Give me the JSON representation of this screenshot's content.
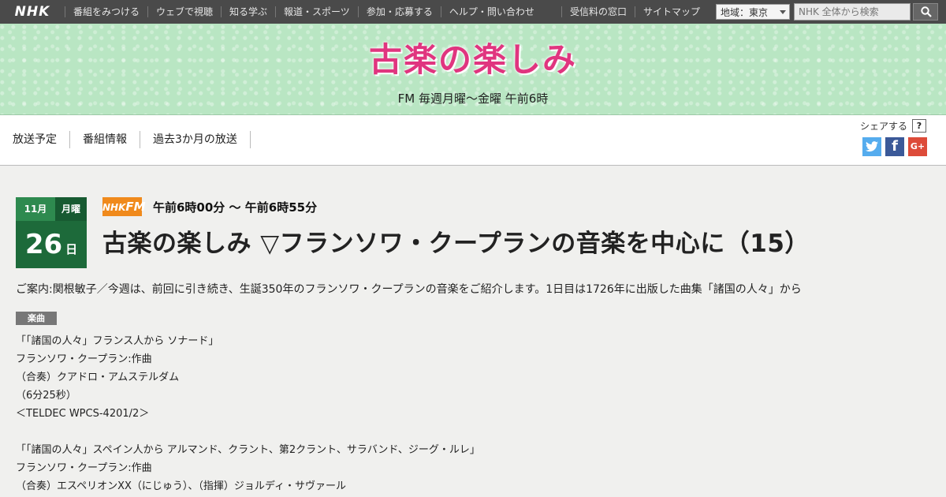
{
  "global_nav": {
    "logo": "NHK",
    "left_items": [
      "番組をみつける",
      "ウェブで視聴",
      "知る学ぶ",
      "報道・スポーツ",
      "参加・応募する",
      "ヘルプ・問い合わせ"
    ],
    "right_items": [
      "受信料の窓口",
      "サイトマップ"
    ],
    "region_label": "地域：東京",
    "search_placeholder": "NHK 全体から検索"
  },
  "banner": {
    "title": "古楽の楽しみ",
    "schedule": "FM 毎週月曜～金曜 午前6時"
  },
  "subnav": {
    "tabs": [
      "放送予定",
      "番組情報",
      "過去3か月の放送"
    ],
    "share_label": "シェアする",
    "help_label": "?",
    "sns": {
      "twitter": "t",
      "facebook": "f",
      "googleplus": "G+"
    }
  },
  "episode": {
    "month": "11月",
    "weekday": "月曜",
    "day": "26",
    "day_unit": "日",
    "channel_badge": {
      "prefix": "NHK",
      "suffix": "FM"
    },
    "airtime": "午前6時00分 ～ 午前6時55分",
    "title": "古楽の楽しみ ▽フランソワ・クープランの音楽を中心に（15）",
    "intro": "ご案内:関根敏子／今週は、前回に引き続き、生誕350年のフランソワ・クープランの音楽をご紹介します。1日目は1726年に出版した曲集「諸国の人々」から",
    "tag": "楽曲",
    "music": [
      [
        "「「諸国の人々」フランス人から ソナード」",
        "フランソワ・クープラン:作曲",
        "（合奏）クアドロ・アムステルダム",
        "（6分25秒）",
        "＜TELDEC WPCS-4201/2＞"
      ],
      [
        "「「諸国の人々」スペイン人から アルマンド、クラント、第2クラント、サラバンド、ジーグ・ルレ」",
        "フランソワ・クープラン:作曲",
        "（合奏）エスペリオンXX（にじゅう）、（指揮）ジョルディ・サヴァール"
      ]
    ]
  },
  "colors": {
    "topbar": "#4a4a4a",
    "banner_bg": "#b9e6c3",
    "title_pink": "#e0357f",
    "date_green": "#1d6a3a",
    "fm_orange": "#f08a1c"
  }
}
